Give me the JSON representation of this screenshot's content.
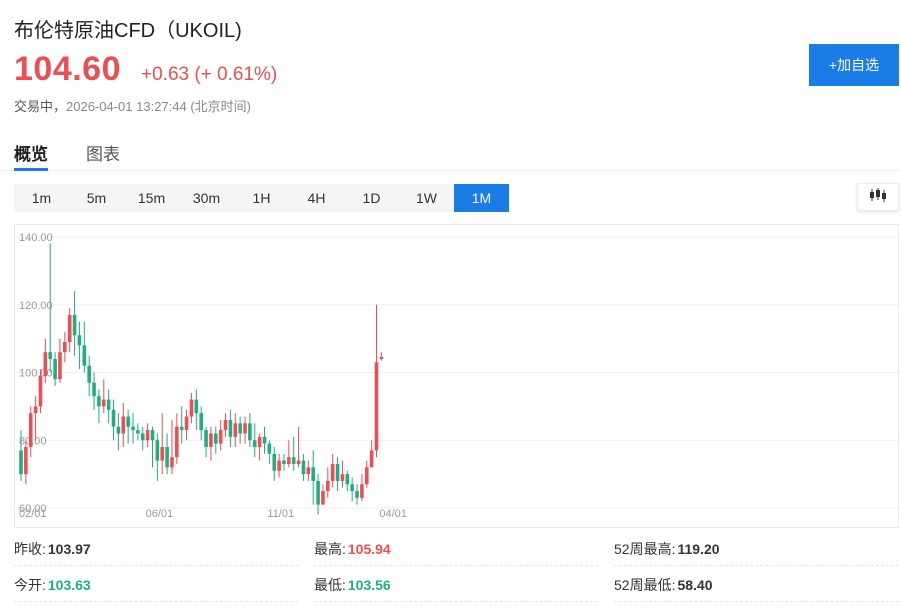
{
  "header": {
    "title": "布伦特原油CFD（UKOIL)",
    "price": "104.60",
    "change": "+0.63 (+ 0.61%)",
    "status": "交易中，",
    "time": "2026-04-01 13:27:44 (北京时间)",
    "add_label": "+加自选"
  },
  "tabs": [
    {
      "label": "概览",
      "active": true
    },
    {
      "label": "图表",
      "active": false
    }
  ],
  "periods": [
    "1m",
    "5m",
    "15m",
    "30m",
    "1H",
    "4H",
    "1D",
    "1W",
    "1M"
  ],
  "active_period": "1M",
  "chart_type_icon": "candlestick-icon",
  "colors": {
    "up": "#ef4d51",
    "down": "#1fae82",
    "accent": "#1a7ce6"
  },
  "chart_data": {
    "type": "candlestick",
    "y_ticks": [
      "140.00",
      "120.00",
      "100.00",
      "80.00",
      "60.00"
    ],
    "ylim": [
      60,
      140
    ],
    "x_ticks": [
      {
        "label": "02/01",
        "index": 0
      },
      {
        "label": "06/01",
        "index": 26
      },
      {
        "label": "11/01",
        "index": 51
      },
      {
        "label": "04/01",
        "index": 74
      }
    ],
    "candles": [
      [
        77,
        70,
        83,
        68
      ],
      [
        70,
        78,
        80,
        67
      ],
      [
        78,
        88,
        90,
        75
      ],
      [
        88,
        90,
        93,
        80
      ],
      [
        90,
        99,
        101,
        88
      ],
      [
        99,
        106,
        110,
        97
      ],
      [
        106,
        104,
        138,
        100
      ],
      [
        104,
        98,
        106,
        96
      ],
      [
        98,
        106,
        110,
        97
      ],
      [
        106,
        109,
        112,
        103
      ],
      [
        109,
        117,
        119,
        106
      ],
      [
        117,
        111,
        124,
        105
      ],
      [
        111,
        108,
        115,
        101
      ],
      [
        108,
        102,
        115,
        100
      ],
      [
        102,
        97,
        105,
        93
      ],
      [
        97,
        93,
        100,
        89
      ],
      [
        93,
        90,
        95,
        85
      ],
      [
        90,
        92,
        98,
        88
      ],
      [
        92,
        89,
        95,
        85
      ],
      [
        89,
        84,
        92,
        80
      ],
      [
        84,
        82,
        88,
        77
      ],
      [
        82,
        87,
        91,
        78
      ],
      [
        87,
        84,
        89,
        79
      ],
      [
        84,
        83,
        88,
        79
      ],
      [
        83,
        82,
        85,
        80
      ],
      [
        82,
        80,
        84,
        77
      ],
      [
        80,
        83,
        85,
        78
      ],
      [
        83,
        80,
        84,
        72
      ],
      [
        80,
        74,
        82,
        68
      ],
      [
        74,
        78,
        88,
        70
      ],
      [
        78,
        72,
        82,
        70
      ],
      [
        72,
        75,
        86,
        70
      ],
      [
        75,
        84,
        88,
        73
      ],
      [
        84,
        83,
        90,
        79
      ],
      [
        83,
        87,
        89,
        80
      ],
      [
        87,
        92,
        94,
        85
      ],
      [
        92,
        88,
        95,
        83
      ],
      [
        88,
        83,
        90,
        80
      ],
      [
        83,
        78,
        84,
        75
      ],
      [
        78,
        82,
        84,
        74
      ],
      [
        82,
        79,
        84,
        76
      ],
      [
        79,
        83,
        86,
        77
      ],
      [
        83,
        86,
        88,
        81
      ],
      [
        86,
        81,
        89,
        78
      ],
      [
        81,
        85,
        88,
        78
      ],
      [
        85,
        82,
        87,
        79
      ],
      [
        82,
        85,
        87,
        79
      ],
      [
        85,
        80,
        88,
        78
      ],
      [
        80,
        78,
        85,
        75
      ],
      [
        78,
        81,
        82,
        74
      ],
      [
        81,
        79,
        84,
        76
      ],
      [
        79,
        76,
        80,
        73
      ],
      [
        76,
        71,
        78,
        68
      ],
      [
        71,
        74,
        76,
        69
      ],
      [
        74,
        73,
        76,
        71
      ],
      [
        73,
        75,
        80,
        72
      ],
      [
        75,
        73,
        81,
        71
      ],
      [
        73,
        74,
        84,
        72
      ],
      [
        74,
        70,
        76,
        68
      ],
      [
        70,
        72,
        74,
        68
      ],
      [
        72,
        68,
        77,
        61
      ],
      [
        68,
        61,
        70,
        58
      ],
      [
        61,
        65,
        67,
        62
      ],
      [
        65,
        68,
        72,
        63
      ],
      [
        68,
        73,
        76,
        66
      ],
      [
        73,
        68,
        75,
        65
      ],
      [
        68,
        70,
        74,
        66
      ],
      [
        70,
        67,
        71,
        65
      ],
      [
        67,
        65,
        69,
        62
      ],
      [
        65,
        63,
        67,
        61
      ],
      [
        63,
        67,
        70,
        62
      ],
      [
        67,
        72,
        74,
        66
      ],
      [
        72,
        77,
        80,
        75
      ],
      [
        77,
        103,
        120,
        75
      ],
      [
        103.97,
        104.6,
        105.94,
        103.56
      ]
    ]
  },
  "stats": [
    {
      "label": "昨收:",
      "value": "103.97",
      "tone": "normal"
    },
    {
      "label": "最高:",
      "value": "105.94",
      "tone": "up"
    },
    {
      "label": "52周最高:",
      "value": "119.20",
      "tone": "normal"
    },
    {
      "label": "今开:",
      "value": "103.63",
      "tone": "down"
    },
    {
      "label": "最低:",
      "value": "103.56",
      "tone": "down"
    },
    {
      "label": "52周最低:",
      "value": "58.40",
      "tone": "normal"
    }
  ]
}
